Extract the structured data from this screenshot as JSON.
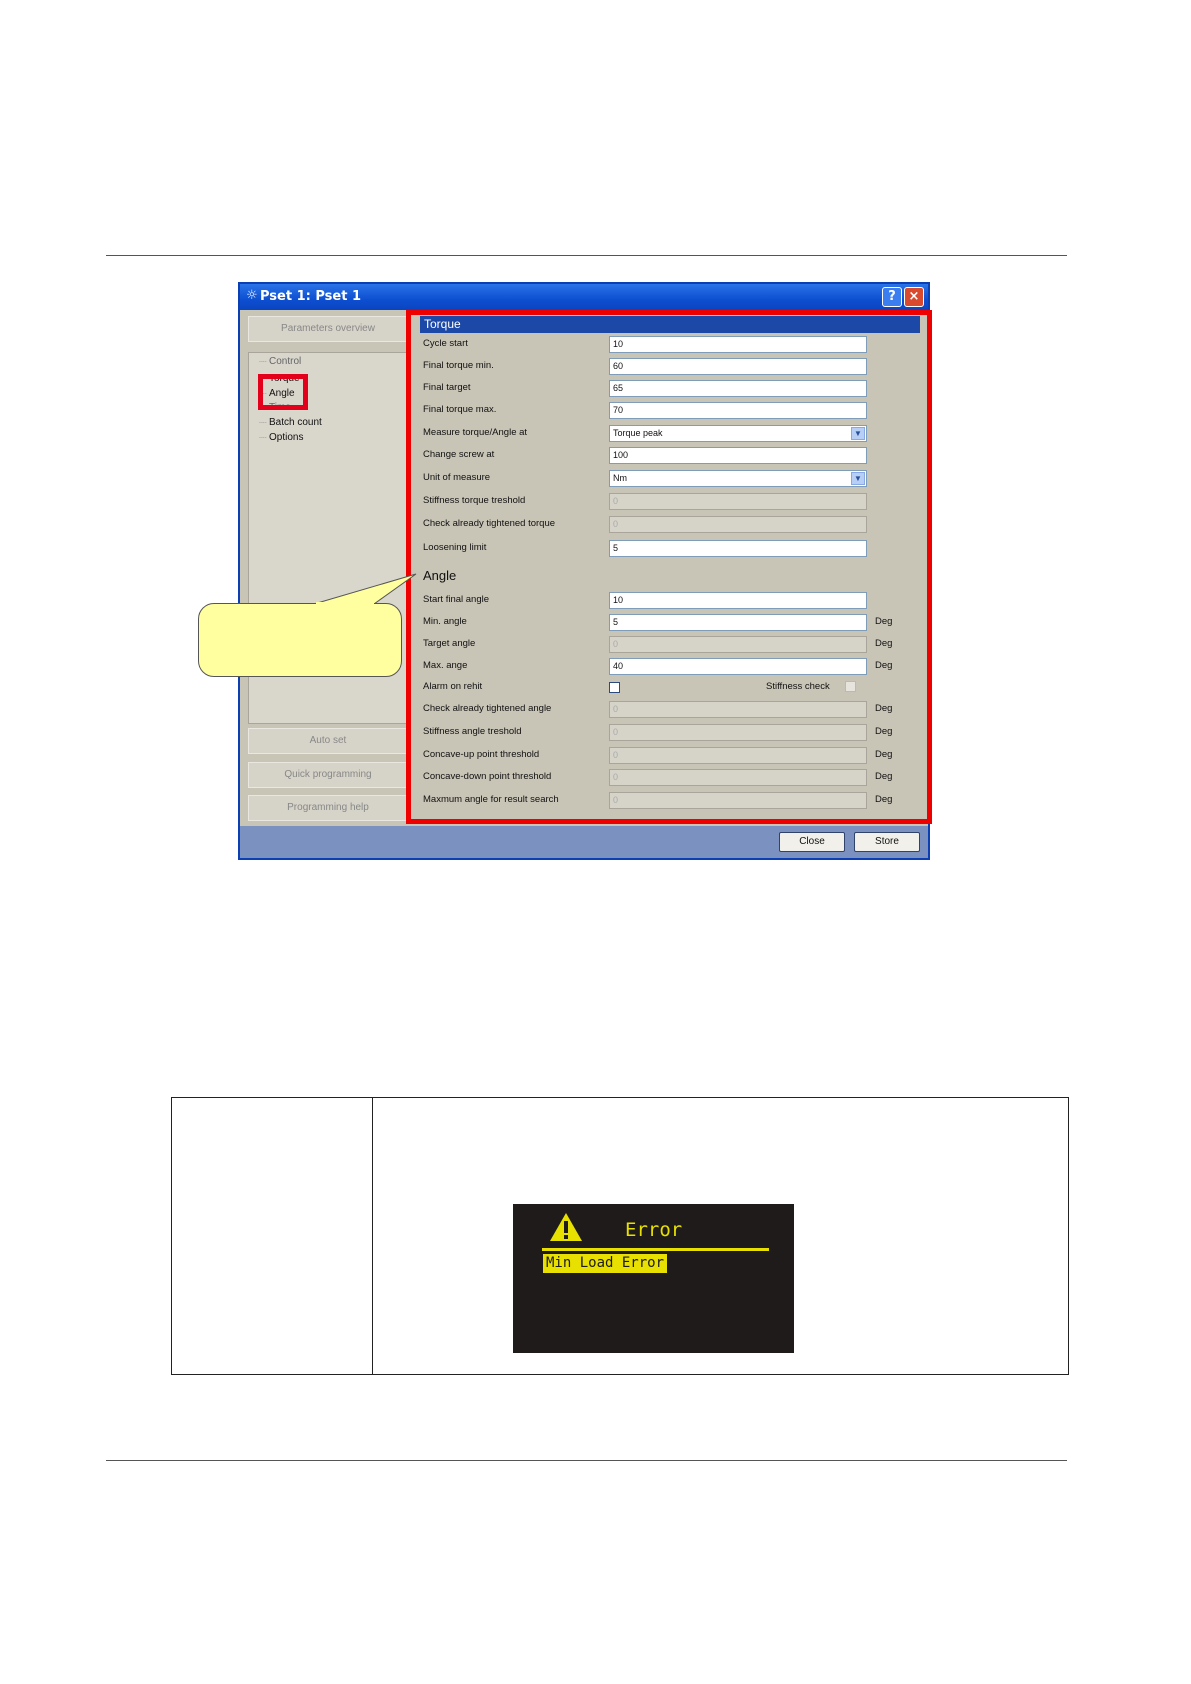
{
  "dialog": {
    "title": "Pset 1: Pset 1",
    "help_label": "?",
    "close_label": "×"
  },
  "left_panel": {
    "overview_button": "Parameters overview",
    "tree": [
      "Control",
      "Torque",
      "Angle",
      "Time",
      "Batch count",
      "Options"
    ],
    "buttons": [
      "Auto set",
      "Quick programming",
      "Programming help"
    ]
  },
  "torque": {
    "heading": "Torque",
    "rows": [
      {
        "label": "Cycle start",
        "value": "10"
      },
      {
        "label": "Final torque min.",
        "value": "60"
      },
      {
        "label": "Final target",
        "value": "65"
      },
      {
        "label": "Final torque max.",
        "value": "70"
      },
      {
        "label": "Measure torque/Angle at",
        "value": "Torque peak"
      },
      {
        "label": "Change screw at",
        "value": "100"
      },
      {
        "label": "Unit of measure",
        "value": "Nm"
      },
      {
        "label": "Stiffness torque treshold",
        "value": "0"
      },
      {
        "label": "Check already tightened torque",
        "value": "0"
      },
      {
        "label": "Loosening limit",
        "value": "5"
      }
    ]
  },
  "angle": {
    "heading": "Angle",
    "rows": [
      {
        "label": "Start final angle",
        "value": "10",
        "unit": ""
      },
      {
        "label": "Min. angle",
        "value": "5",
        "unit": "Deg"
      },
      {
        "label": "Target angle",
        "value": "0",
        "unit": "Deg"
      },
      {
        "label": "Max. ange",
        "value": "40",
        "unit": "Deg"
      },
      {
        "label": "Alarm on rehit",
        "value": "",
        "unit": ""
      },
      {
        "label": "Check already tightened angle",
        "value": "0",
        "unit": "Deg"
      },
      {
        "label": "Stiffness angle treshold",
        "value": "0",
        "unit": "Deg"
      },
      {
        "label": "Concave-up point threshold",
        "value": "0",
        "unit": "Deg"
      },
      {
        "label": "Concave-down point threshold",
        "value": "0",
        "unit": "Deg"
      },
      {
        "label": "Maxmum angle for result search",
        "value": "0",
        "unit": "Deg"
      }
    ],
    "stiffness_check_label": "Stiffness check"
  },
  "footer": {
    "close_button": "Close",
    "store_button": "Store"
  },
  "lcd": {
    "title": "Error",
    "message": "Min Load Error"
  },
  "colors": {
    "highlight_red": "#e3001b",
    "lcd_yellow": "#e8e000",
    "callout_yellow": "#ffffa0",
    "header_blue": "#1c48a8"
  }
}
